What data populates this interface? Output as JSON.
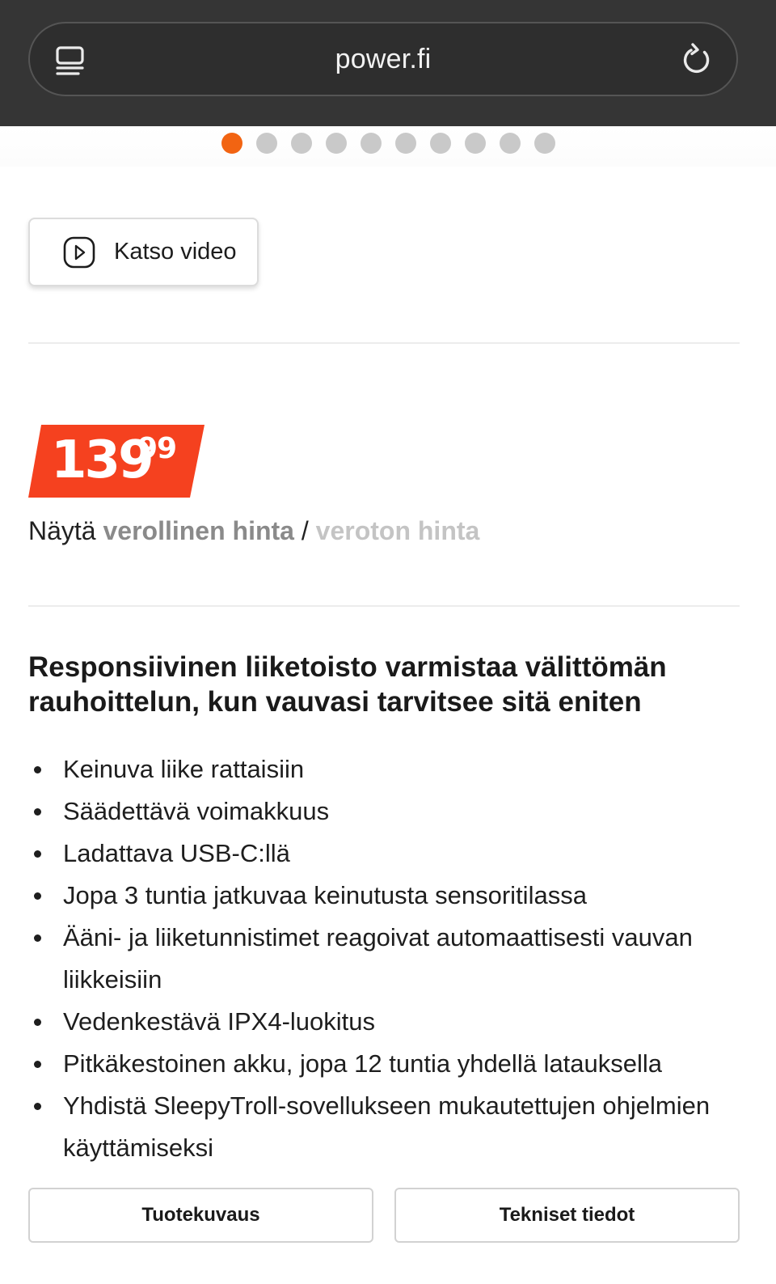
{
  "browser": {
    "url": "power.fi",
    "icons": [
      "tabs-icon",
      "reload-icon"
    ]
  },
  "carousel": {
    "total_dots": 10,
    "active_index": 0,
    "active_color": "#f26412",
    "inactive_color": "#c9c9c9"
  },
  "video": {
    "label": "Katso video",
    "icon": "play-icon"
  },
  "price": {
    "main": "139",
    "cents": "99",
    "tag_color": "#f5411f"
  },
  "vat_toggle": {
    "prefix": "Näytä",
    "incl": "verollinen hinta",
    "separator": "/",
    "excl": "veroton hinta"
  },
  "description": {
    "headline": "Responsiivinen liiketoisto varmistaa välittömän rauhoittelun, kun vauvasi tarvitsee sitä eniten",
    "features": [
      "Keinuva liike rattaisiin",
      "Säädettävä voimakkuus",
      "Ladattava USB-C:llä",
      "Jopa 3 tuntia jatkuvaa keinutusta sensoritilassa",
      "Ääni- ja liiketunnistimet reagoivat automaattisesti vauvan liikkeisiin",
      "Vedenkestävä IPX4-luokitus",
      "Pitkäkestoinen akku, jopa 12 tuntia yhdellä latauksella",
      "Yhdistä SleepyTroll-sovellukseen mukautettujen ohjelmien käyttämiseksi"
    ]
  },
  "tabs": {
    "product_description": "Tuotekuvaus",
    "specifications": "Tekniset tiedot"
  }
}
